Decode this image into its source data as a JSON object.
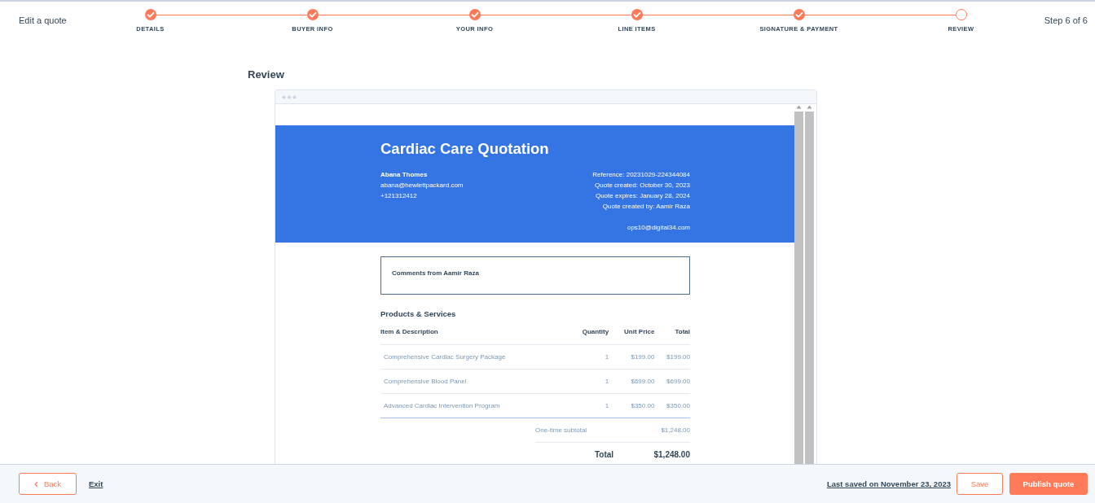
{
  "header": {
    "title": "Edit a quote",
    "step_count": "Step 6 of 6"
  },
  "steps": [
    {
      "label": "DETAILS",
      "completed": true
    },
    {
      "label": "BUYER INFO",
      "completed": true
    },
    {
      "label": "YOUR INFO",
      "completed": true
    },
    {
      "label": "LINE ITEMS",
      "completed": true
    },
    {
      "label": "SIGNATURE & PAYMENT",
      "completed": true
    },
    {
      "label": "REVIEW",
      "completed": false
    }
  ],
  "section_title": "Review",
  "quote": {
    "title": "Cardiac Care Quotation",
    "buyer": {
      "name": "Abana Thomes",
      "email": "abana@hewlettpackard.com",
      "phone": "+121312412"
    },
    "meta": [
      "Reference: 20231029-224344084",
      "Quote created: October 30, 2023",
      "Quote expires: January 28, 2024",
      "Quote created by: Aamir Raza"
    ],
    "seller_email": "ops10@digital34.com",
    "comments_title": "Comments from Aamir Raza",
    "products_title": "Products & Services",
    "columns": [
      "Item & Description",
      "Quantity",
      "Unit Price",
      "Total"
    ],
    "rows": [
      [
        "Comprehensive Cardiac Surgery Package",
        "1",
        "$199.00",
        "$199.00"
      ],
      [
        "Comprehensive Blood Panel",
        "1",
        "$699.00",
        "$699.00"
      ],
      [
        "Advanced Cardiac Intervention Program",
        "1",
        "$350.00",
        "$350.00"
      ]
    ],
    "subtotal": {
      "label": "One-time subtotal",
      "value": "$1,248.00"
    },
    "total": {
      "label": "Total",
      "value": "$1,248.00"
    }
  },
  "footer": {
    "back": "Back",
    "exit": "Exit",
    "last_saved": "Last saved on November 23, 2023",
    "save": "Save",
    "publish": "Publish quote"
  }
}
